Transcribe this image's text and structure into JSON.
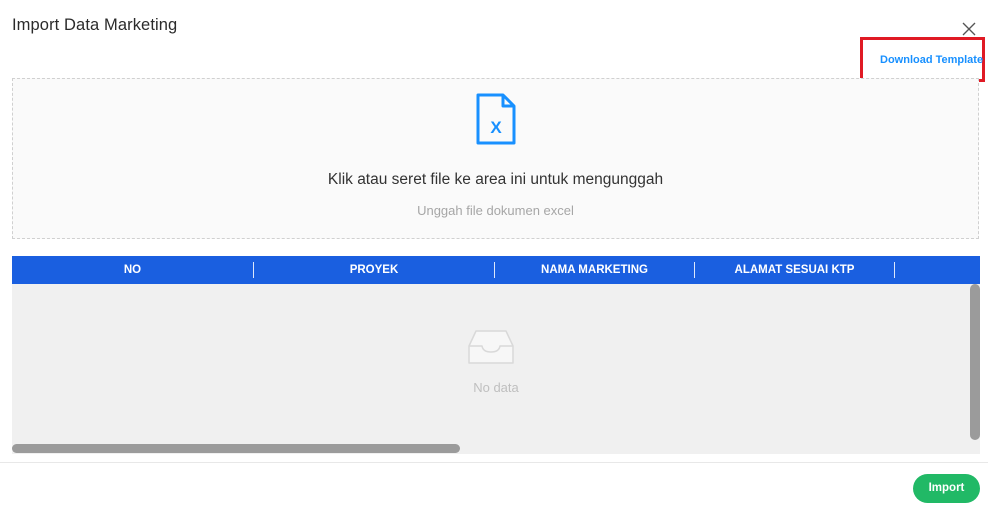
{
  "modal": {
    "title": "Import Data Marketing",
    "close_icon": "close-icon"
  },
  "download_template": {
    "label": "Download Template",
    "color": "#1890ff",
    "highlight_color": "#e01a24"
  },
  "upload": {
    "icon": "excel-file-icon",
    "text": "Klik atau seret file ke area ini untuk mengunggah",
    "hint": "Unggah file dokumen excel",
    "icon_color": "#1890ff"
  },
  "table": {
    "header_color": "#1a5fe0",
    "columns": [
      "NO",
      "PROYEK",
      "NAMA MARKETING",
      "ALAMAT SESUAI KTP"
    ],
    "rows": [],
    "empty_icon": "inbox-icon",
    "empty_text": "No data"
  },
  "footer": {
    "import_label": "Import",
    "import_color": "#21b966"
  }
}
